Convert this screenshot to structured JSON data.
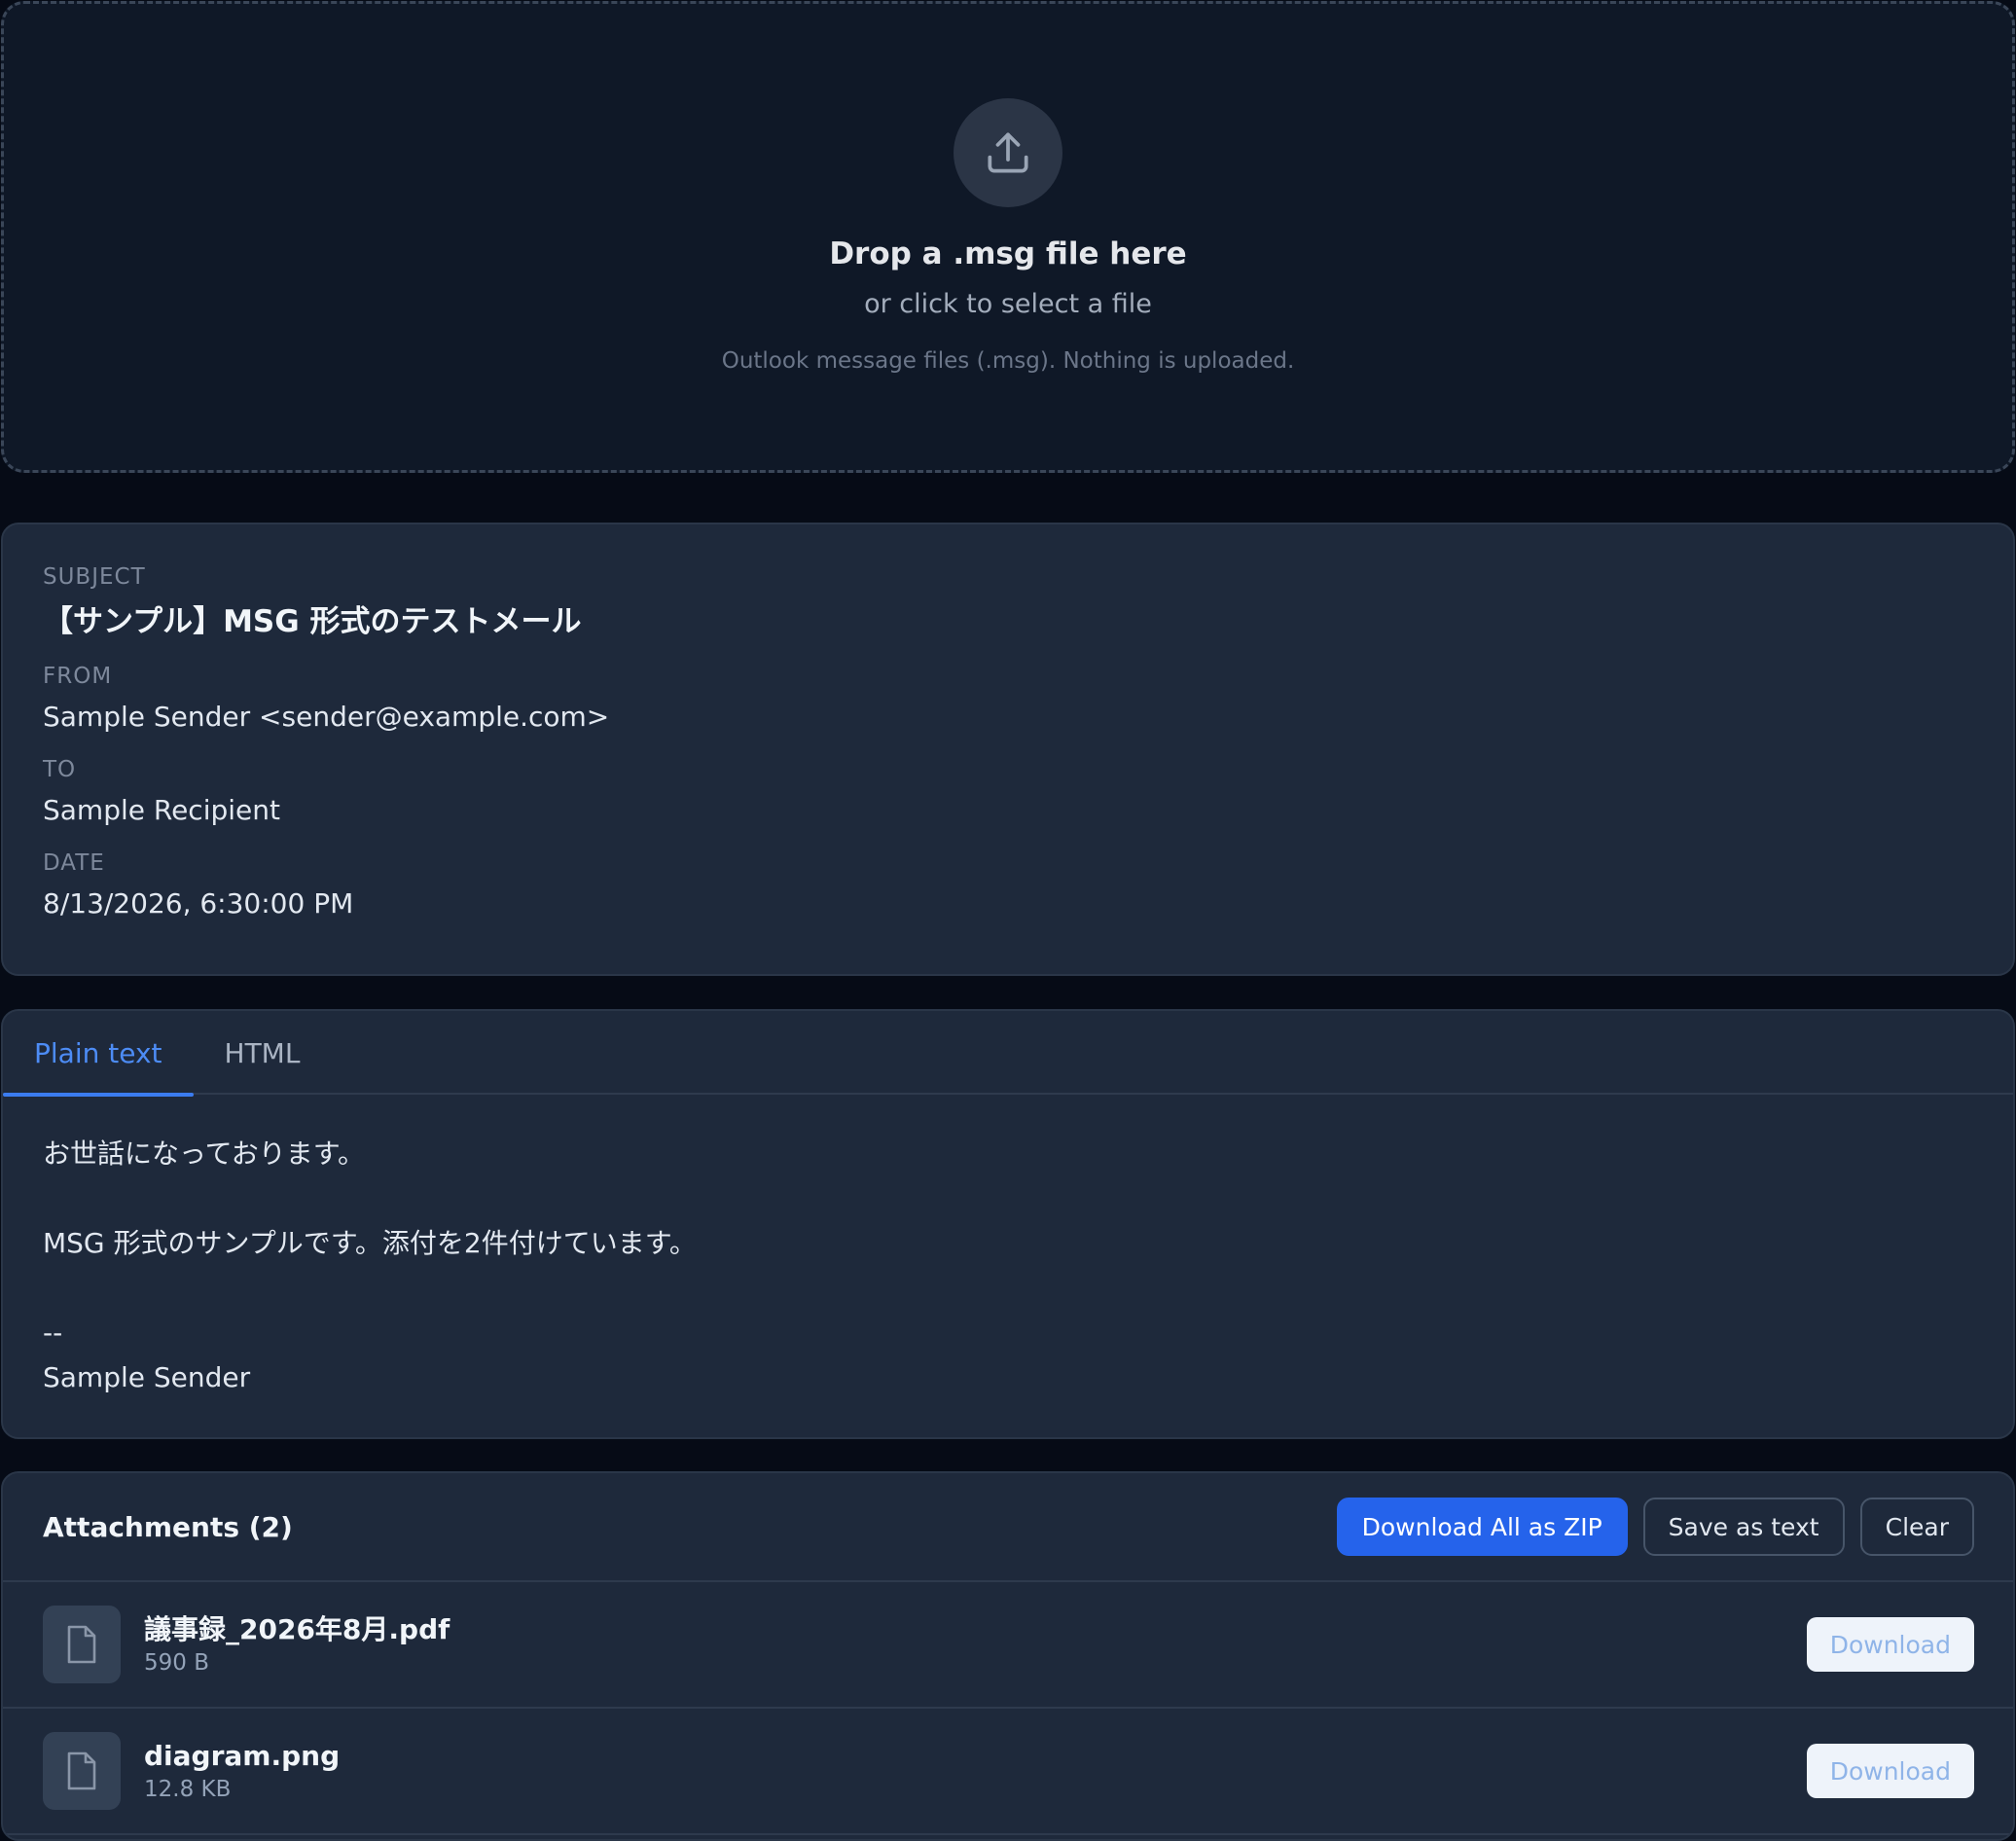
{
  "dropzone": {
    "icon": "upload-icon",
    "title": "Drop a .msg file here",
    "subtitle": "or click to select a file",
    "note": "Outlook message files (.msg). Nothing is uploaded."
  },
  "message_meta": {
    "subject_label": "SUBJECT",
    "subject": "【サンプル】MSG 形式のテストメール",
    "from_label": "FROM",
    "from": "Sample Sender <sender@example.com>",
    "to_label": "TO",
    "to": "Sample Recipient",
    "date_label": "DATE",
    "date": "8/13/2026, 6:30:00 PM"
  },
  "body": {
    "tabs": [
      {
        "label": "Plain text",
        "active": true
      },
      {
        "label": "HTML",
        "active": false
      }
    ],
    "lines": [
      "お世話になっております。",
      "",
      "MSG 形式のサンプルです。添付を2件付けています。",
      "",
      "--",
      "Sample Sender"
    ]
  },
  "attachments": {
    "title": "Attachments (2)",
    "download_all_label": "Download All as ZIP",
    "save_text_label": "Save as text",
    "clear_label": "Clear",
    "items": [
      {
        "name": "議事録_2026年8月.pdf",
        "size": "590 B",
        "icon": "file-icon",
        "action": "Download"
      },
      {
        "name": "diagram.png",
        "size": "12.8 KB",
        "icon": "file-icon",
        "action": "Download"
      }
    ]
  },
  "colors": {
    "background": "#060b16",
    "card": "#1e293b",
    "accent": "#2563eb",
    "active_tab": "#4d8cf5"
  }
}
